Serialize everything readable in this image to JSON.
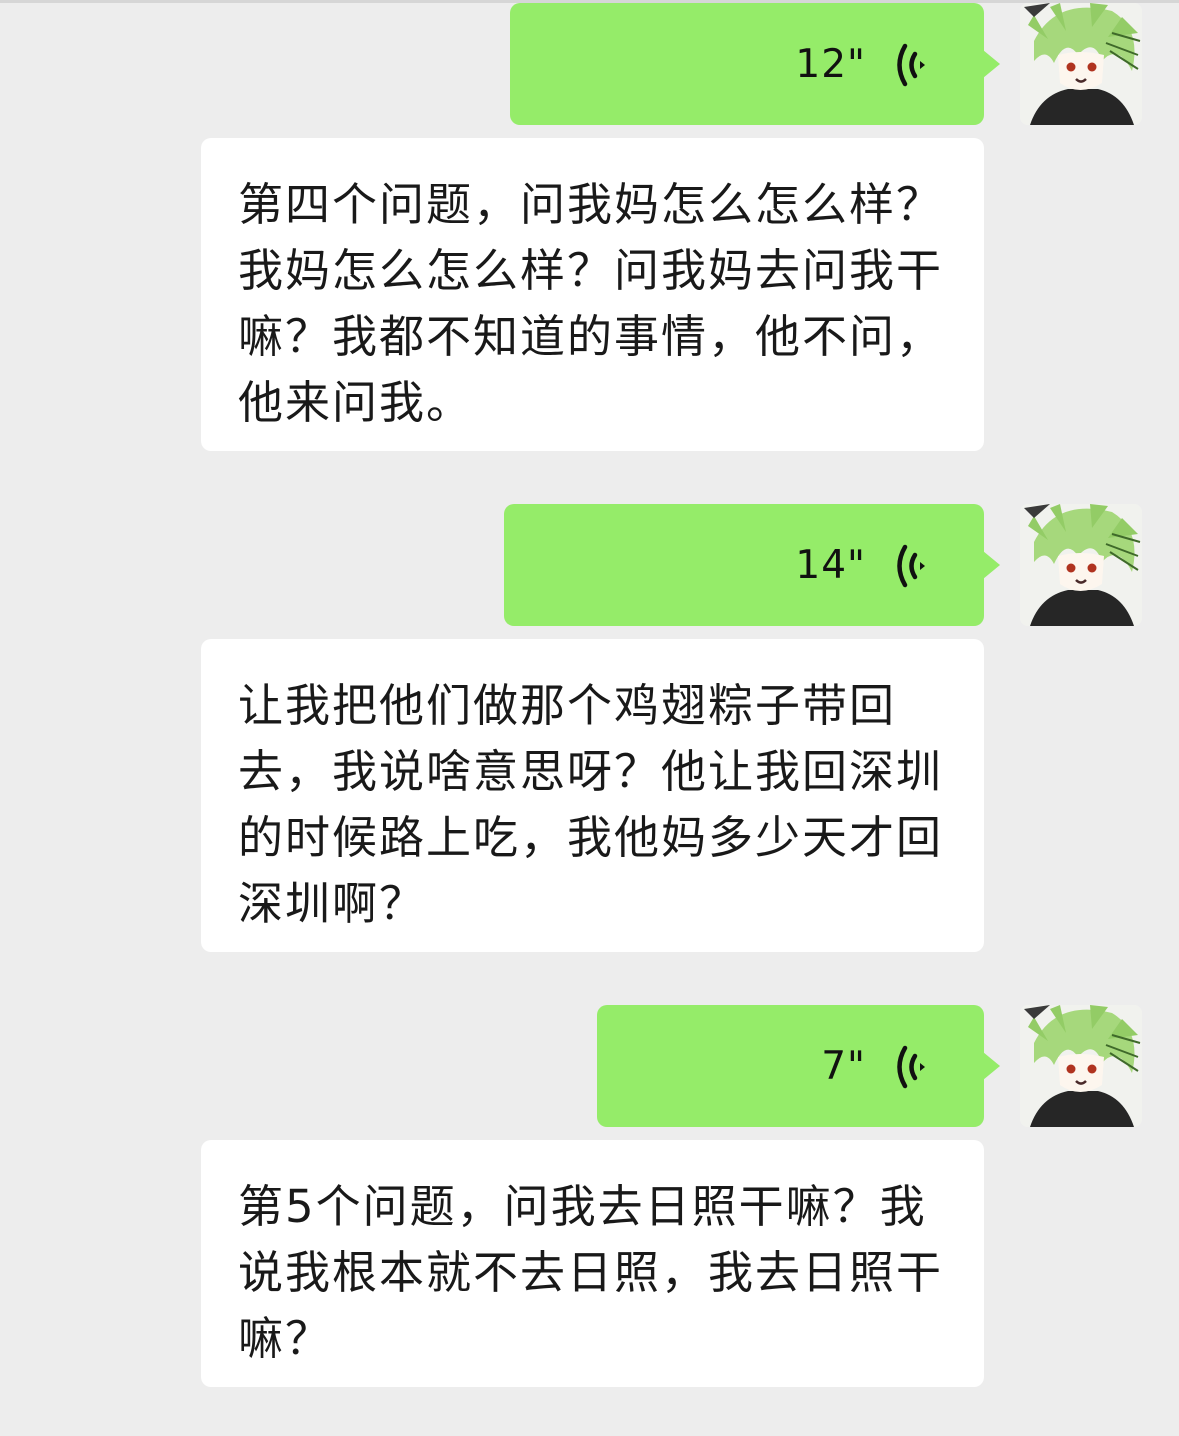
{
  "chat": {
    "messages": [
      {
        "kind": "voice",
        "duration": "12\""
      },
      {
        "kind": "text",
        "text": "第四个问题，问我妈怎么怎么样？我妈怎么怎么样？问我妈去问我干嘛？我都不知道的事情，他不问，他来问我。"
      },
      {
        "kind": "voice",
        "duration": "14\""
      },
      {
        "kind": "text",
        "text": "让我把他们做那个鸡翅粽子带回去，我说啥意思呀？他让我回深圳的时候路上吃，我他妈多少天才回深圳啊？"
      },
      {
        "kind": "voice",
        "duration": "7\""
      },
      {
        "kind": "text",
        "text": "第5个问题，问我去日照干嘛？我说我根本就不去日照，我去日照干嘛？"
      }
    ]
  },
  "icons": {
    "voice": "voice-wave-icon",
    "avatar": "anime-character-avatar"
  },
  "colors": {
    "background": "#ededed",
    "voice_bubble": "#95ec69",
    "text_bubble": "#ffffff",
    "text": "#191919"
  }
}
